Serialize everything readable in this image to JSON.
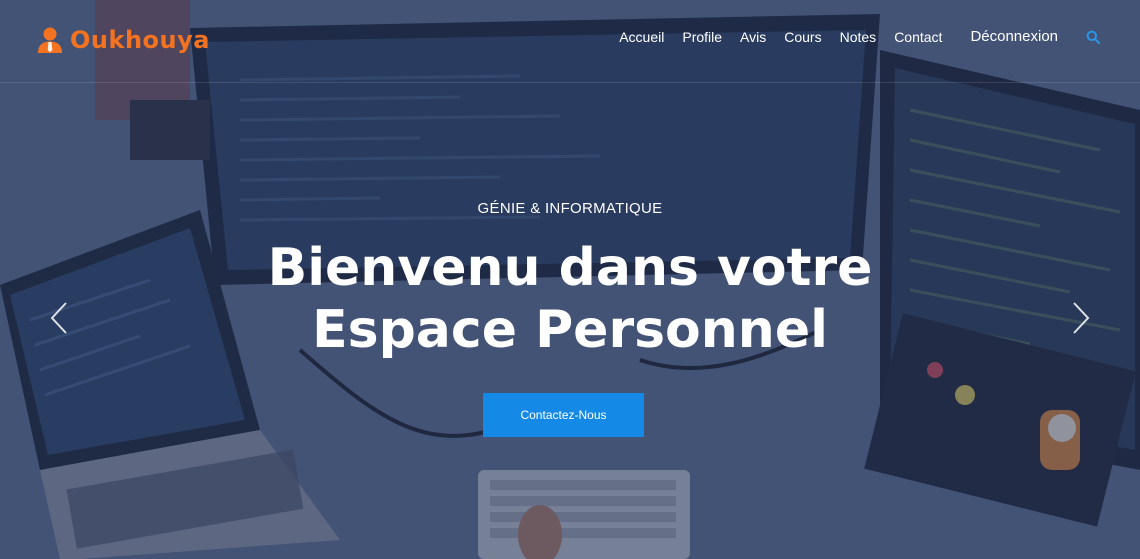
{
  "brand": {
    "name": "Oukhouya",
    "accent": "#f37321",
    "icon": "user-tie-icon"
  },
  "nav": {
    "items": [
      "Accueil",
      "Profile",
      "Avis",
      "Cours",
      "Notes",
      "Contact"
    ],
    "logout": "Déconnexion",
    "search_icon": "search-icon",
    "search_color": "#2a96e6"
  },
  "hero": {
    "kicker": "GÉNIE & INFORMATIQUE",
    "title_line1": "Bienvenu dans votre",
    "title_line2": "Espace Personnel",
    "cta": "Contactez-Nous",
    "cta_color": "#1589e6",
    "prev_icon": "chevron-left-icon",
    "next_icon": "chevron-right-icon"
  }
}
